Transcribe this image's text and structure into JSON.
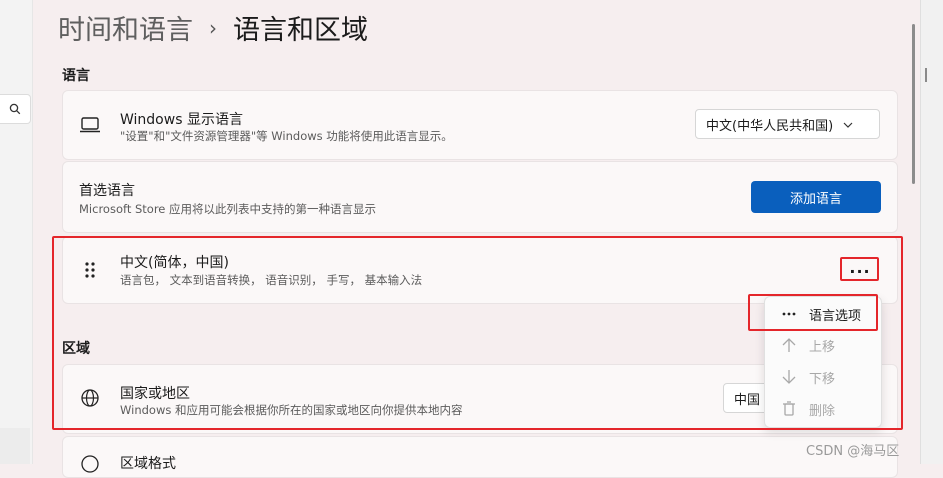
{
  "breadcrumb": {
    "parent": "时间和语言",
    "separator": "›",
    "current": "语言和区域"
  },
  "sections": {
    "language": "语言",
    "region": "区域"
  },
  "windows_display_language": {
    "title": "Windows 显示语言",
    "subtitle": "\"设置\"和\"文件资源管理器\"等 Windows 功能将使用此语言显示。",
    "dropdown_value": "中文(中华人民共和国)",
    "icon": "laptop-icon"
  },
  "preferred_languages": {
    "title": "首选语言",
    "subtitle": "Microsoft Store 应用将以此列表中支持的第一种语言显示",
    "add_button": "添加语言"
  },
  "language_item": {
    "title": "中文(简体，中国)",
    "subtitle": "语言包， 文本到语音转换， 语音识别， 手写， 基本输入法",
    "more_label": "···",
    "icon": "drag-handle-icon"
  },
  "context_menu": {
    "items": [
      {
        "label": "语言选项",
        "icon": "more-icon",
        "enabled": true
      },
      {
        "label": "上移",
        "icon": "arrow-up-icon",
        "enabled": false
      },
      {
        "label": "下移",
        "icon": "arrow-down-icon",
        "enabled": false
      },
      {
        "label": "删除",
        "icon": "trash-icon",
        "enabled": false
      }
    ]
  },
  "country_region": {
    "title": "国家或地区",
    "subtitle": "Windows 和应用可能会根据你所在的国家或地区向你提供本地内容",
    "dropdown_value": "中国",
    "icon": "globe-icon"
  },
  "region_format": {
    "title": "区域格式"
  },
  "watermark": "CSDN @海马区",
  "colors": {
    "accent": "#0a5fbd",
    "highlight": "#e4262b"
  }
}
